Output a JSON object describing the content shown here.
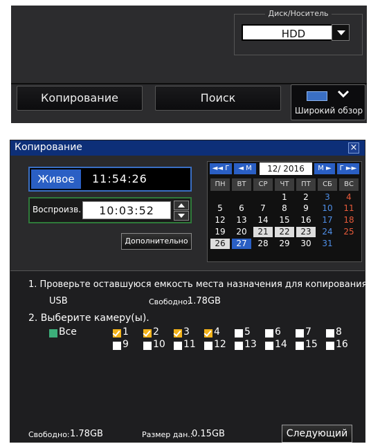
{
  "top_panel": {
    "disk_label": "Диск/Носитель",
    "disk_value": "HDD",
    "copy_tab": "Копирование",
    "search_tab": "Поиск",
    "wide_view": "Широкий обзор"
  },
  "dialog": {
    "title": "Копирование",
    "close": "×",
    "live_label": "Живое",
    "live_time": "11:54:26",
    "playback_label": "Воспроизв.",
    "playback_time": "10:03:52",
    "advanced_button": "Дополнительно",
    "calendar": {
      "nav_year_prev": "◄◄ Г",
      "nav_month_prev": "◄ М",
      "month_year": "12/ 2016",
      "nav_month_next": "М ►",
      "nav_year_next": "Г ►►",
      "weekdays": [
        "ПН",
        "ВТ",
        "СР",
        "ЧТ",
        "ПТ",
        "СБ",
        "ВС"
      ],
      "days": [
        "1",
        "2",
        "3",
        "4",
        "5",
        "6",
        "7",
        "8",
        "9",
        "10",
        "11",
        "12",
        "13",
        "14",
        "15",
        "16",
        "17",
        "18",
        "19",
        "20",
        "21",
        "22",
        "23",
        "24",
        "25",
        "26",
        "27",
        "28",
        "29",
        "30",
        "31"
      ]
    },
    "step1": "1. Проверьте оставшуюся емкость места назначения для копирования.",
    "destination": "USB",
    "free_label": "Свободно:",
    "free_value": "1.78GB",
    "step2": "2. Выберите камеру(ы).",
    "all_label": "Все",
    "cameras": [
      "1",
      "2",
      "3",
      "4",
      "5",
      "6",
      "7",
      "8",
      "9",
      "10",
      "11",
      "12",
      "13",
      "14",
      "15",
      "16"
    ],
    "checked_cameras": [
      "1",
      "2",
      "3",
      "4"
    ],
    "footer_free_label": "Свободно:",
    "footer_free_value": "1.78GB",
    "data_size_label": "Размер дан.:",
    "data_size_value": "0.15GB",
    "next_button": "Следующий"
  },
  "colors": {
    "title_bar": "#0d2f78",
    "accent_blue": "#2a5fc4",
    "checked": "#f2b21a",
    "all_checkbox": "#3cae7a",
    "saturday": "#4f8fe8",
    "sunday": "#e85a3a"
  }
}
